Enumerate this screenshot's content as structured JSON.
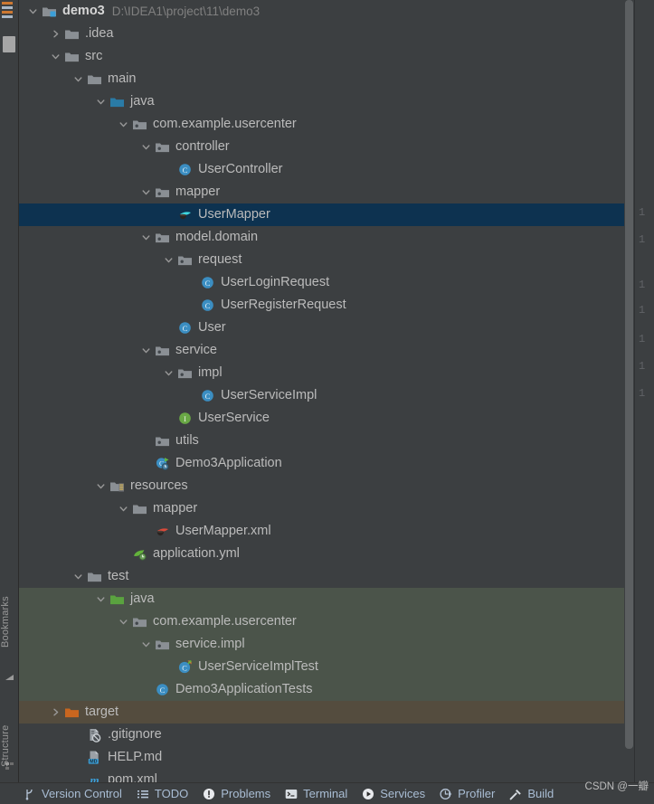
{
  "theme": {
    "panel_bg": "#3c3f41",
    "selection_bg": "#0d3250",
    "test_source_bg": "#4b544a",
    "excluded_bg": "#544c3e",
    "text": "#bbbbbb",
    "muted_text": "#808080",
    "accent_blue": "#3b8ec2",
    "accent_green": "#6ca644",
    "accent_orange": "#cc7832"
  },
  "left_toolbar": {
    "tabs": [
      {
        "label": "Bookmarks",
        "icon": "bookmarks-icon"
      },
      {
        "label": "Structure",
        "icon": "structure-icon"
      }
    ]
  },
  "project_tree": {
    "rows": [
      {
        "depth": 0,
        "arrow": "down",
        "icon": "module-folder-icon",
        "label": "demo3",
        "bold": true,
        "path": "D:\\IDEA1\\project\\11\\demo3",
        "state": "normal"
      },
      {
        "depth": 1,
        "arrow": "right",
        "icon": "folder-icon",
        "label": ".idea",
        "state": "normal"
      },
      {
        "depth": 1,
        "arrow": "down",
        "icon": "folder-icon",
        "label": "src",
        "state": "normal"
      },
      {
        "depth": 2,
        "arrow": "down",
        "icon": "folder-icon",
        "label": "main",
        "state": "normal"
      },
      {
        "depth": 3,
        "arrow": "down",
        "icon": "source-root-icon",
        "label": "java",
        "state": "normal"
      },
      {
        "depth": 4,
        "arrow": "down",
        "icon": "package-icon",
        "label": "com.example.usercenter",
        "state": "normal"
      },
      {
        "depth": 5,
        "arrow": "down",
        "icon": "package-icon",
        "label": "controller",
        "state": "normal"
      },
      {
        "depth": 6,
        "arrow": "none",
        "icon": "java-class-icon",
        "label": "UserController",
        "state": "normal"
      },
      {
        "depth": 5,
        "arrow": "down",
        "icon": "package-icon",
        "label": "mapper",
        "state": "normal"
      },
      {
        "depth": 6,
        "arrow": "none",
        "icon": "mybatis-mapper-icon",
        "label": "UserMapper",
        "state": "selected"
      },
      {
        "depth": 5,
        "arrow": "down",
        "icon": "package-icon",
        "label": "model.domain",
        "state": "normal"
      },
      {
        "depth": 6,
        "arrow": "down",
        "icon": "package-icon",
        "label": "request",
        "state": "normal"
      },
      {
        "depth": 7,
        "arrow": "none",
        "icon": "java-class-icon",
        "label": "UserLoginRequest",
        "state": "normal"
      },
      {
        "depth": 7,
        "arrow": "none",
        "icon": "java-class-icon",
        "label": "UserRegisterRequest",
        "state": "normal"
      },
      {
        "depth": 6,
        "arrow": "none",
        "icon": "java-class-icon",
        "label": "User",
        "state": "normal"
      },
      {
        "depth": 5,
        "arrow": "down",
        "icon": "package-icon",
        "label": "service",
        "state": "normal"
      },
      {
        "depth": 6,
        "arrow": "down",
        "icon": "package-icon",
        "label": "impl",
        "state": "normal"
      },
      {
        "depth": 7,
        "arrow": "none",
        "icon": "java-class-icon",
        "label": "UserServiceImpl",
        "state": "normal"
      },
      {
        "depth": 6,
        "arrow": "none",
        "icon": "java-interface-icon",
        "label": "UserService",
        "state": "normal"
      },
      {
        "depth": 5,
        "arrow": "none",
        "icon": "package-icon",
        "label": "utils",
        "state": "normal"
      },
      {
        "depth": 5,
        "arrow": "none",
        "icon": "spring-boot-app-icon",
        "label": "Demo3Application",
        "state": "normal"
      },
      {
        "depth": 3,
        "arrow": "down",
        "icon": "resource-root-icon",
        "label": "resources",
        "state": "normal"
      },
      {
        "depth": 4,
        "arrow": "down",
        "icon": "folder-icon",
        "label": "mapper",
        "state": "normal"
      },
      {
        "depth": 5,
        "arrow": "none",
        "icon": "mybatis-xml-icon",
        "label": "UserMapper.xml",
        "state": "normal"
      },
      {
        "depth": 4,
        "arrow": "none",
        "icon": "spring-yaml-icon",
        "label": "application.yml",
        "state": "normal"
      },
      {
        "depth": 2,
        "arrow": "down",
        "icon": "folder-icon",
        "label": "test",
        "state": "normal"
      },
      {
        "depth": 3,
        "arrow": "down",
        "icon": "test-source-root-icon",
        "label": "java",
        "state": "test"
      },
      {
        "depth": 4,
        "arrow": "down",
        "icon": "package-icon",
        "label": "com.example.usercenter",
        "state": "test"
      },
      {
        "depth": 5,
        "arrow": "down",
        "icon": "package-icon",
        "label": "service.impl",
        "state": "test"
      },
      {
        "depth": 6,
        "arrow": "none",
        "icon": "java-test-class-icon",
        "label": "UserServiceImplTest",
        "state": "test"
      },
      {
        "depth": 5,
        "arrow": "none",
        "icon": "java-class-icon",
        "label": "Demo3ApplicationTests",
        "state": "test"
      },
      {
        "depth": 1,
        "arrow": "right",
        "icon": "excluded-folder-icon",
        "label": "target",
        "state": "excluded"
      },
      {
        "depth": 2,
        "arrow": "none",
        "icon": "gitignore-icon",
        "label": ".gitignore",
        "state": "normal"
      },
      {
        "depth": 2,
        "arrow": "none",
        "icon": "markdown-icon",
        "label": "HELP.md",
        "state": "normal"
      },
      {
        "depth": 2,
        "arrow": "none",
        "icon": "maven-pom-icon",
        "label": "pom.xml",
        "state": "normal"
      }
    ]
  },
  "editor_gutter": {
    "line_numbers": [
      "1",
      "1",
      "1",
      "1",
      "1",
      "1",
      "1"
    ]
  },
  "status_bar": {
    "items": [
      {
        "label": "Version Control",
        "icon": "branch-icon"
      },
      {
        "label": "TODO",
        "icon": "todo-list-icon"
      },
      {
        "label": "Problems",
        "icon": "problems-icon"
      },
      {
        "label": "Terminal",
        "icon": "terminal-icon"
      },
      {
        "label": "Services",
        "icon": "services-play-icon"
      },
      {
        "label": "Profiler",
        "icon": "profiler-icon"
      },
      {
        "label": "Build",
        "icon": "build-hammer-icon"
      }
    ]
  },
  "watermark": {
    "text": "CSDN @一瓣"
  }
}
